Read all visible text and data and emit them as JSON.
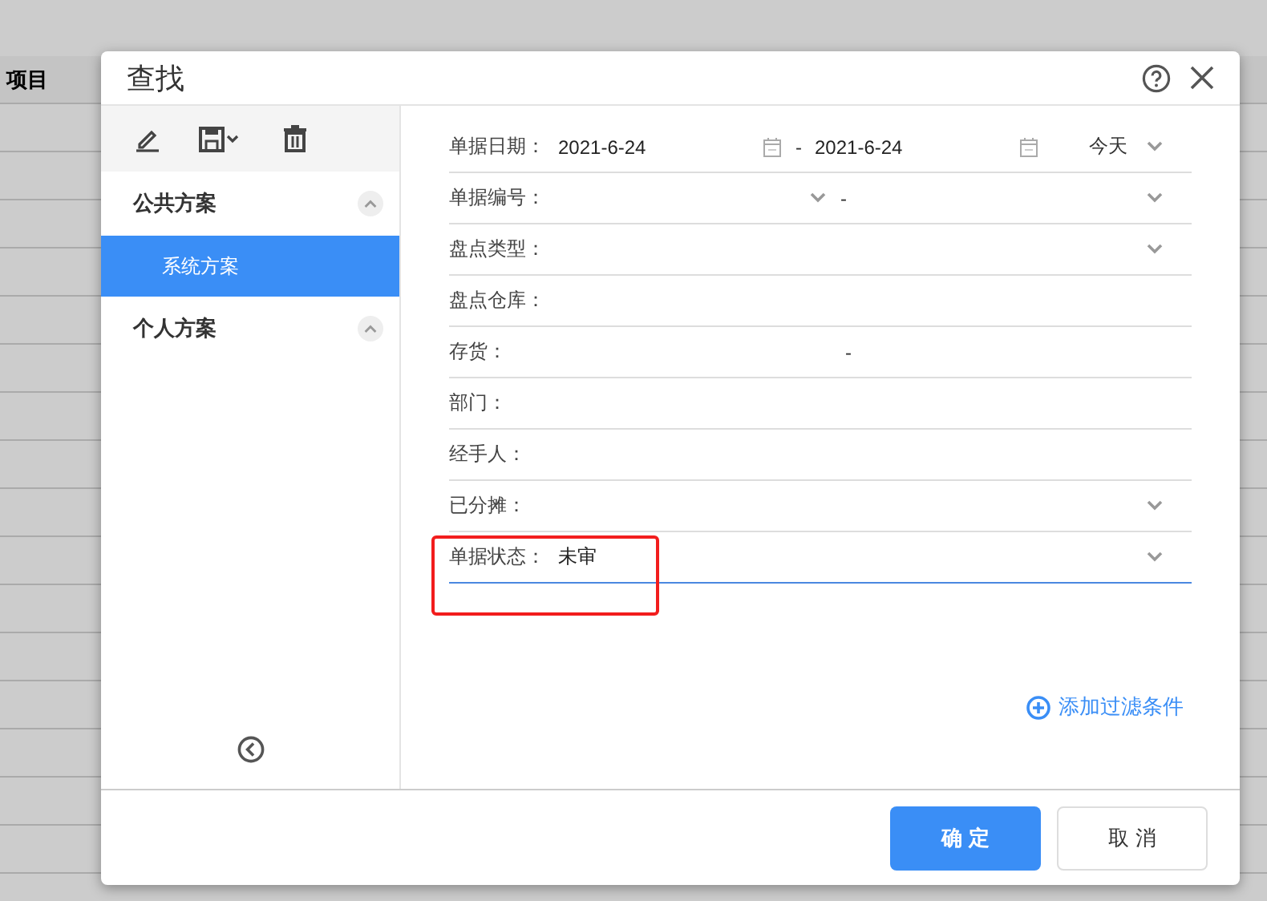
{
  "background_table": {
    "header": "项目"
  },
  "dialog": {
    "title": "查找"
  },
  "sidebar": {
    "groups": [
      {
        "label": "公共方案",
        "expanded": true,
        "items": [
          {
            "label": "系统方案",
            "selected": true
          }
        ]
      },
      {
        "label": "个人方案",
        "expanded": true
      }
    ]
  },
  "filters": [
    {
      "kind": "date_range",
      "label": "单据日期：",
      "from": "2021-6-24",
      "separator": "-",
      "to": "2021-6-24",
      "preset": "今天",
      "focused": false,
      "highlighted": false
    },
    {
      "kind": "select_range",
      "label": "单据编号：",
      "separator": "-",
      "focused": false,
      "highlighted": false
    },
    {
      "kind": "select",
      "label": "盘点类型：",
      "focused": false,
      "highlighted": false
    },
    {
      "kind": "text",
      "label": "盘点仓库：",
      "focused": false,
      "highlighted": false
    },
    {
      "kind": "text_range",
      "label": "存货：",
      "separator": "-",
      "focused": false,
      "highlighted": false
    },
    {
      "kind": "text",
      "label": "部门：",
      "focused": false,
      "highlighted": false
    },
    {
      "kind": "text",
      "label": "经手人：",
      "focused": false,
      "highlighted": false
    },
    {
      "kind": "select",
      "label": "已分摊：",
      "focused": false,
      "highlighted": false
    },
    {
      "kind": "select",
      "label": "单据状态：",
      "value": "未审",
      "focused": true,
      "highlighted": true
    }
  ],
  "add_filter": "添加过滤条件",
  "buttons": [
    {
      "label": "确 定",
      "kind": "primary"
    },
    {
      "label": "取 消",
      "kind": "secondary"
    }
  ]
}
